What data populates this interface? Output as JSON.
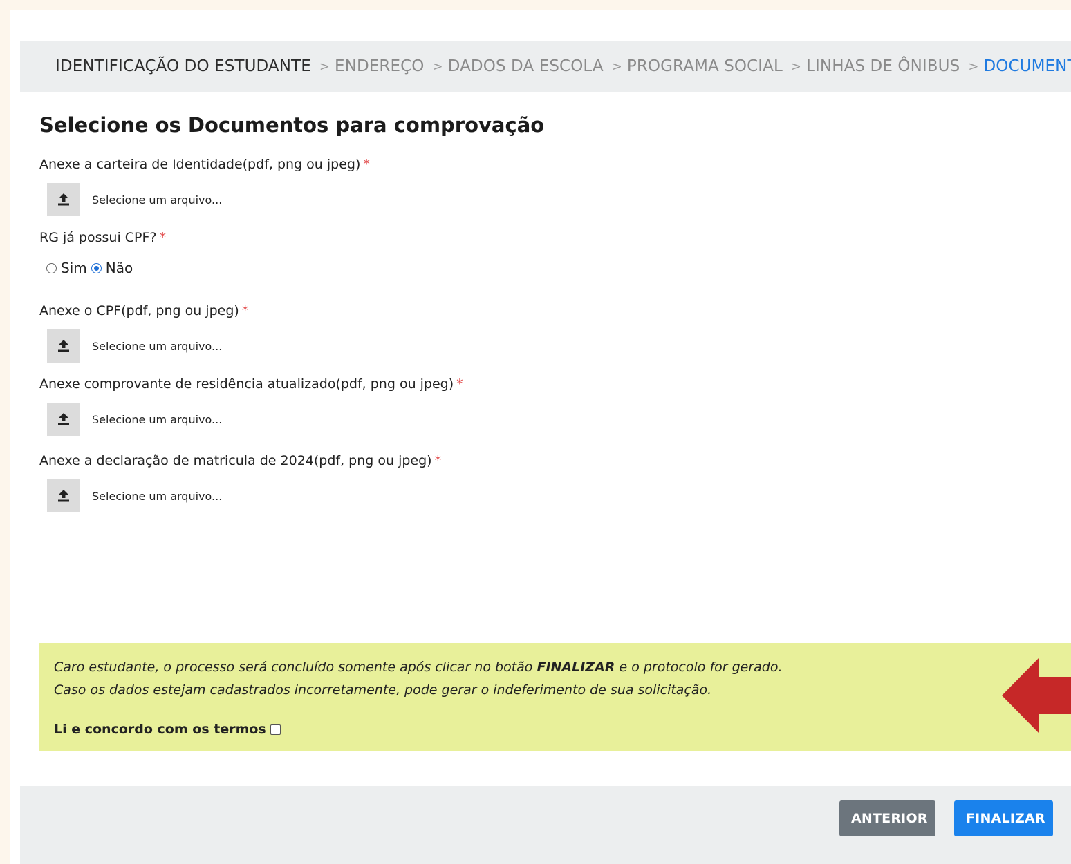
{
  "breadcrumb": {
    "steps": [
      {
        "label": "IDENTIFICAÇÃO DO ESTUDANTE",
        "state": "done"
      },
      {
        "label": "ENDEREÇO",
        "state": "pending"
      },
      {
        "label": "DADOS DA ESCOLA",
        "state": "pending"
      },
      {
        "label": "PROGRAMA SOCIAL",
        "state": "pending"
      },
      {
        "label": "LINHAS DE ÔNIBUS",
        "state": "pending"
      },
      {
        "label": "DOCUMENTAÇÃO",
        "state": "active"
      }
    ],
    "separator": ">"
  },
  "form": {
    "title": "Selecione os Documentos para comprovação",
    "required_mark": "*",
    "file_placeholder": "Selecione um arquivo...",
    "identity_label": "Anexe a carteira de Identidade(pdf, png ou jpeg)",
    "cpf_question": "RG já possui CPF?",
    "cpf_options": [
      "Sim",
      "Não"
    ],
    "cpf_selected": "Não",
    "cpf_label": "Anexe o CPF(pdf, png ou jpeg)",
    "residence_label": "Anexe comprovante de residência atualizado(pdf, png ou jpeg)",
    "enrollment_label": "Anexe a declaração de matricula de 2024(pdf, png ou jpeg)"
  },
  "notice": {
    "line1_prefix": "Caro estudante, o processo será concluído somente após clicar no botão ",
    "line1_bold": "FINALIZAR",
    "line1_suffix": " e o protocolo for gerado.",
    "line2": "Caso os dados estejam cadastrados incorretamente, pode gerar o indeferimento de sua solicitação.",
    "terms_label": "Li e concordo com os termos",
    "terms_checked": false
  },
  "footer": {
    "prev_label": "ANTERIOR",
    "finish_label": "FINALIZAR"
  },
  "colors": {
    "active_step": "#1f7ae0",
    "notice_bg": "#e8f09a",
    "arrow": "#c62828",
    "prev_button": "#6c757d",
    "finish_button": "#1a82ec"
  },
  "icons": {
    "upload": "upload-icon",
    "annotation_arrow": "arrow-left-icon"
  }
}
